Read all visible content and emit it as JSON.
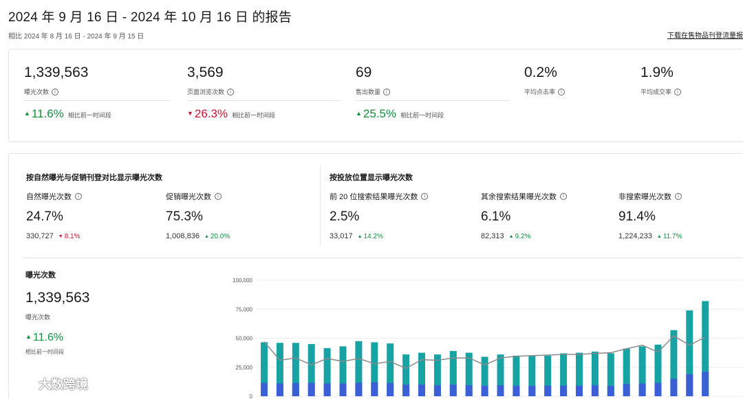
{
  "header": {
    "title": "2024 年 9 月 16 日 - 2024 年 10 月 16 日 的报告",
    "comparison": "相比 2024 年 8 月 16 日 - 2024 年 9 月 15 日",
    "download_link": "下载在售物品刊登流量报"
  },
  "kpis": [
    {
      "value": "1,339,563",
      "label": "曝光次数",
      "change": "11.6%",
      "direction": "up",
      "note": "相比前一时间段"
    },
    {
      "value": "3,569",
      "label": "页面浏览次数",
      "change": "26.3%",
      "direction": "down",
      "note": "相比前一时间段"
    },
    {
      "value": "69",
      "label": "售出数量",
      "change": "25.5%",
      "direction": "up",
      "note": "相比前一时间段"
    },
    {
      "value": "0.2%",
      "label": "平均点击率"
    },
    {
      "value": "1.9%",
      "label": "平均成交率"
    }
  ],
  "organic_promoted": {
    "title": "按自然曝光与促销刊登对比显示曝光次数",
    "metrics": [
      {
        "label": "自然曝光次数",
        "value": "24.7%",
        "count": "330,727",
        "change": "8.1%",
        "direction": "down"
      },
      {
        "label": "促销曝光次数",
        "value": "75.3%",
        "count": "1,008,836",
        "change": "20.0%",
        "direction": "up"
      }
    ]
  },
  "placement": {
    "title": "按投放位置显示曝光次数",
    "metrics": [
      {
        "label": "前 20 位搜索结果曝光次数",
        "value": "2.5%",
        "count": "33,017",
        "change": "14.2%",
        "direction": "up"
      },
      {
        "label": "其余搜索结果曝光次数",
        "value": "6.1%",
        "count": "82,313",
        "change": "9.2%",
        "direction": "up"
      },
      {
        "label": "非搜索曝光次数",
        "value": "91.4%",
        "count": "1,224,233",
        "change": "11.7%",
        "direction": "up"
      }
    ]
  },
  "impressions": {
    "title": "曝光次数",
    "value": "1,339,563",
    "label": "曝光次数",
    "change": "11.6%",
    "direction": "up",
    "note": "相比前一时间段"
  },
  "chart_data": {
    "type": "bar",
    "stacked": true,
    "ylim": [
      0,
      100000
    ],
    "yticks": [
      "100,000",
      "75,000",
      "50,000",
      "25,000",
      "0"
    ],
    "series": [
      {
        "values": [
          11500,
          11000,
          11500,
          11500,
          11000,
          11000,
          11500,
          12000,
          11500,
          10000,
          10000,
          9500,
          10000,
          9500,
          9000,
          9500,
          9000,
          9000,
          9000,
          9000,
          9000,
          9500,
          9000,
          10500,
          11000,
          11500,
          15000,
          19000,
          21000
        ]
      },
      {
        "values": [
          46500,
          46000,
          46000,
          45000,
          41500,
          43000,
          47500,
          46500,
          45500,
          36000,
          37500,
          36000,
          39000,
          37500,
          34000,
          36000,
          35000,
          35000,
          35000,
          37000,
          37500,
          38500,
          37000,
          41000,
          43000,
          44500,
          57000,
          74000,
          82000
        ]
      },
      {
        "values": [
          47000,
          31000,
          33000,
          27000,
          32500,
          30000,
          32500,
          28000,
          30000,
          24000,
          31500,
          31000,
          33000,
          33000,
          27000,
          33000,
          34500,
          35000,
          35500,
          36000,
          36000,
          37000,
          37500,
          41000,
          44000,
          38000,
          52000,
          44000,
          51000
        ]
      }
    ],
    "colors": {
      "teal": "#17a2a4",
      "blue": "#3b5fd6",
      "line": "#8a8a8a"
    }
  },
  "watermark": {
    "text": "大数跨境"
  }
}
